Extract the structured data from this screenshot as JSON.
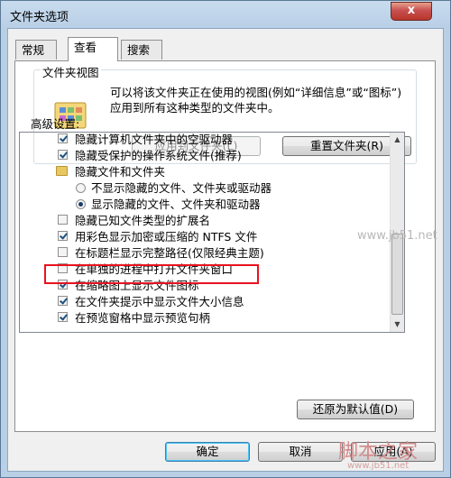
{
  "window": {
    "title": "文件夹选项",
    "close_label": "x"
  },
  "tabs": [
    {
      "label": "常规"
    },
    {
      "label": "查看"
    },
    {
      "label": "搜索"
    }
  ],
  "folder_views": {
    "group_label": "文件夹视图",
    "description": "可以将该文件夹正在使用的视图(例如“详细信息”或“图标”)应用到所有这种类型的文件夹中。",
    "apply_button": "应用到文件夹(L)",
    "reset_button": "重置文件夹(R)"
  },
  "advanced": {
    "label": "高级设置:",
    "items": [
      {
        "type": "checkbox",
        "checked": true,
        "label": "隐藏计算机文件夹中的空驱动器"
      },
      {
        "type": "checkbox",
        "checked": true,
        "label": "隐藏受保护的操作系统文件(推荐)"
      },
      {
        "type": "folder",
        "label": "隐藏文件和文件夹"
      },
      {
        "type": "radio",
        "checked": false,
        "label": "不显示隐藏的文件、文件夹或驱动器"
      },
      {
        "type": "radio",
        "checked": true,
        "label": "显示隐藏的文件、文件夹和驱动器"
      },
      {
        "type": "checkbox",
        "checked": false,
        "label": "隐藏已知文件类型的扩展名"
      },
      {
        "type": "checkbox",
        "checked": true,
        "label": "用彩色显示加密或压缩的 NTFS 文件"
      },
      {
        "type": "checkbox",
        "checked": false,
        "label": "在标题栏显示完整路径(仅限经典主题)"
      },
      {
        "type": "checkbox",
        "checked": false,
        "label": "在单独的进程中打开文件夹窗口"
      },
      {
        "type": "checkbox",
        "checked": true,
        "label": "在缩略图上显示文件图标"
      },
      {
        "type": "checkbox",
        "checked": true,
        "label": "在文件夹提示中显示文件大小信息"
      },
      {
        "type": "checkbox",
        "checked": true,
        "label": "在预览窗格中显示预览句柄"
      }
    ],
    "restore_button": "还原为默认值(D)"
  },
  "footer": {
    "ok": "确定",
    "cancel": "取消",
    "apply": "应用(A)"
  },
  "watermarks": {
    "site": "www.jb51.net",
    "brand": "脚本之家",
    "brand_url": "www.jb51.net"
  }
}
